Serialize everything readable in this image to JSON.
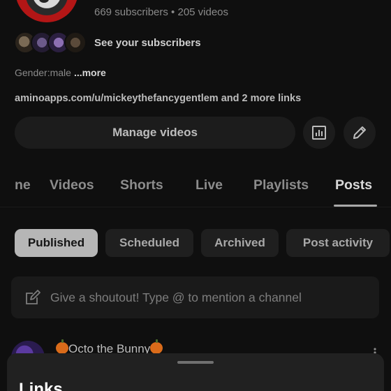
{
  "channel": {
    "stats": "669 subscribers • 205 videos",
    "see_subscribers": "See your subscribers",
    "about_text": "Gender:male",
    "more_label": "...more",
    "link_text": "aminoapps.com/u/mickeythefancygentlem",
    "link_extra": "and 2 more links"
  },
  "actions": {
    "manage_videos": "Manage videos"
  },
  "tabs": [
    {
      "label": "ne"
    },
    {
      "label": "Videos"
    },
    {
      "label": "Shorts"
    },
    {
      "label": "Live"
    },
    {
      "label": "Playlists"
    },
    {
      "label": "Posts"
    }
  ],
  "active_tab": "Posts",
  "filters": [
    {
      "label": "Published",
      "selected": true
    },
    {
      "label": "Scheduled"
    },
    {
      "label": "Archived"
    },
    {
      "label": "Post activity"
    }
  ],
  "composer": {
    "placeholder": "Give a shoutout! Type @ to mention a channel"
  },
  "post": {
    "author": "Octo the Bunny"
  },
  "sheet": {
    "title": "Links"
  },
  "icons": {
    "analytics": "analytics-icon",
    "edit": "pencil-icon",
    "composer": "edit-note-icon",
    "menu": "more-vert-icon"
  },
  "colors": {
    "background": "#0f0f0f",
    "surface": "#1c1c1c",
    "selected_chip": "#b6b6b6",
    "sheet": "#212121"
  }
}
